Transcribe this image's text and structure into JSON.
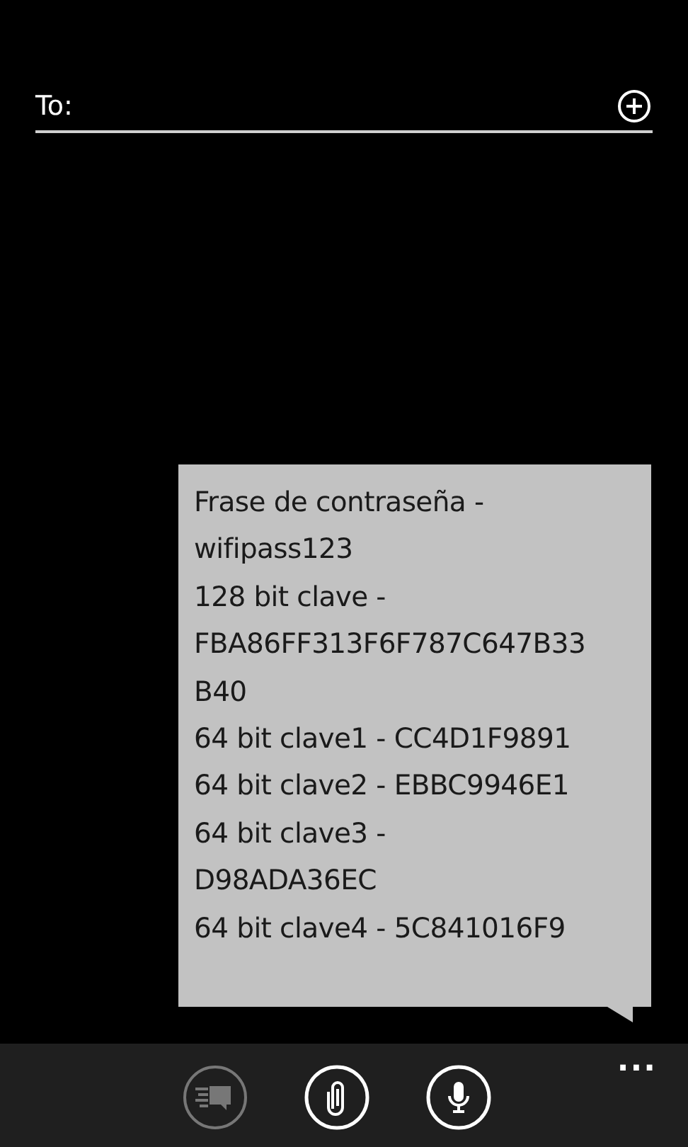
{
  "to_field": {
    "label": "To:"
  },
  "message": {
    "text": "Frase de contraseña -\nwifipass123\n128 bit clave -\nFBA86FF313F6F787C647B33\nB40\n64 bit clave1 - CC4D1F9891\n64 bit clave2 - EBBC9946E1\n64 bit clave3 -\nD98ADA36EC\n64 bit clave4 - 5C841016F9"
  },
  "app_bar": {
    "buttons": [
      {
        "kind": "send",
        "disabled": true
      },
      {
        "kind": "attach",
        "disabled": false
      },
      {
        "kind": "voice",
        "disabled": false
      }
    ],
    "more": "..."
  }
}
